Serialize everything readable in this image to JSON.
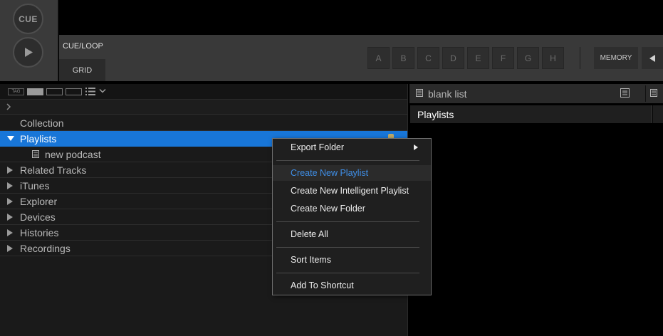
{
  "deck": {
    "cue_label": "CUE",
    "cueloop_label": "CUE/LOOP",
    "grid_label": "GRID",
    "hot_cues": [
      "A",
      "B",
      "C",
      "D",
      "E",
      "F",
      "G",
      "H"
    ],
    "memory_label": "MEMORY"
  },
  "browser": {
    "tag_label": "TAG",
    "tree": [
      {
        "label": "Collection",
        "expandable": false
      },
      {
        "label": "Playlists",
        "expandable": true,
        "expanded": true,
        "selected": true
      },
      {
        "label": "new podcast",
        "child": true
      },
      {
        "label": "Related Tracks",
        "expandable": true
      },
      {
        "label": "iTunes",
        "expandable": true
      },
      {
        "label": "Explorer",
        "expandable": true
      },
      {
        "label": "Devices",
        "expandable": true
      },
      {
        "label": "Histories",
        "expandable": true
      },
      {
        "label": "Recordings",
        "expandable": true
      }
    ]
  },
  "right_panel": {
    "title": "blank list",
    "column_header": "Playlists"
  },
  "context_menu": {
    "items": [
      {
        "label": "Export Folder",
        "submenu": true
      },
      {
        "label": "Create New Playlist",
        "highlighted": true
      },
      {
        "label": "Create New Intelligent Playlist"
      },
      {
        "label": "Create New Folder"
      },
      {
        "label": "Delete All"
      },
      {
        "label": "Sort Items"
      },
      {
        "label": "Add To Shortcut"
      }
    ]
  },
  "colors": {
    "selection": "#1876d8",
    "menu_highlight_text": "#3f8fe8",
    "panel_bg": "#1a1a1a"
  },
  "icons": [
    "play-icon",
    "list-view-icon",
    "chevron-down-icon",
    "chevron-right-icon",
    "triangle-right-icon",
    "triangle-down-icon",
    "playlist-doc-icon",
    "submenu-arrow-icon",
    "arrow-left-icon"
  ]
}
